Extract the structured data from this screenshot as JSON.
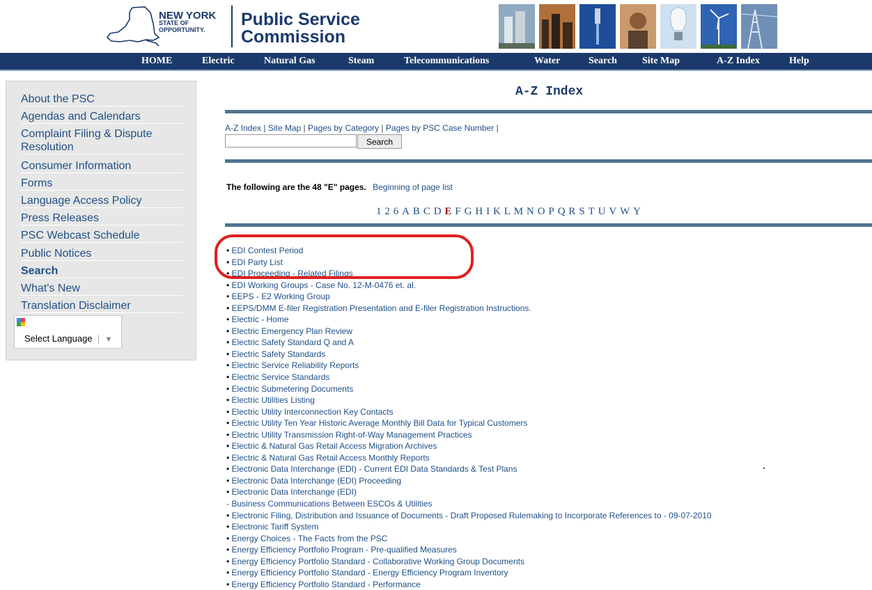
{
  "header": {
    "logo_line1": "NEW YORK",
    "logo_line2": "STATE OF",
    "logo_line3": "OPPORTUNITY.",
    "title_line1": "Public Service",
    "title_line2": "Commission",
    "brand_color": "#1b3a6b"
  },
  "nav": {
    "items": [
      "HOME",
      "Electric",
      "Natural Gas",
      "Steam",
      "Telecommunications",
      "Water",
      "Search",
      "Site Map",
      "A-Z Index",
      "Help"
    ]
  },
  "sidebar": {
    "items": [
      {
        "label": "About the PSC"
      },
      {
        "label": "Agendas and Calendars"
      },
      {
        "label": "Complaint Filing & Dispute Resolution"
      },
      {
        "label": "Consumer Information"
      },
      {
        "label": "Forms"
      },
      {
        "label": "Language Access Policy"
      },
      {
        "label": "Press Releases"
      },
      {
        "label": "PSC Webcast Schedule"
      },
      {
        "label": "Public Notices"
      },
      {
        "label": "Search"
      },
      {
        "label": "What's New"
      },
      {
        "label": "Translation Disclaimer"
      }
    ],
    "language_select": "Select Language"
  },
  "main": {
    "page_title": "A-Z Index",
    "subnav": [
      "A-Z Index",
      "Site Map",
      "Pages by Category",
      "Pages by PSC Case Number"
    ],
    "search_button": "Search",
    "search_value": "",
    "intro": "The following are the 48 \"E\" pages.",
    "beginning_link": "Beginning of page list",
    "letters": [
      "1",
      "2",
      "6",
      "A",
      "B",
      "C",
      "D",
      "E",
      "F",
      "G",
      "H",
      "I",
      "K",
      "L",
      "M",
      "N",
      "O",
      "P",
      "Q",
      "R",
      "S",
      "T",
      "U",
      "V",
      "W",
      "Y"
    ],
    "active_letter": "E",
    "entries": [
      "EDI Contest Period",
      "EDI Party List",
      "EDI Proceeding - Related Filings",
      "EDI Working Groups - Case No. 12-M-0476 et. al.",
      "EEPS - E2 Working Group",
      "EEPS/DMM E-filer Registration Presentation and E-filer Registration Instructions.",
      "Electric - Home",
      "Electric Emergency Plan Review",
      "Electric Safety Standard Q and A",
      "Electric Safety Standards",
      "Electric Service Reliability Reports",
      "Electric Service Standards",
      "Electric Submetering Documents",
      "Electric Utilities Listing",
      "Electric Utility Interconnection Key Contacts",
      "Electric Utility Ten Year Historic Average Monthly Bill Data for Typical Customers",
      "Electric Utility Transmission Right-of-Way Management Practices",
      "Electric & Natural Gas Retail Access Migration Archives",
      "Electric & Natural Gas Retail Access Monthly Reports",
      "Electronic Data Interchange (EDI) - Current EDI Data Standards & Test Plans",
      "Electronic Data Interchange (EDI) Proceeding",
      "Electronic Data Interchange (EDI)",
      "- Business Communications Between ESCOs & Utilities",
      "Electronic Filing, Distribution and Issuance of Documents - Draft Proposed Rulemaking to Incorporate References to - 09-07-2010",
      "Electronic Tariff System",
      "Energy Choices - The Facts from the PSC",
      "Energy Efficiency Portfolio Program - Pre-qualified Measures",
      "Energy Efficiency Portfolio Standard - Collaborative Working Group Documents",
      "Energy Efficiency Portfolio Standard - Energy Efficiency Program Inventory",
      "Energy Efficiency Portfolio Standard - Performance"
    ],
    "link_color": "#1f4f86",
    "highlight_color": "#e02020"
  }
}
